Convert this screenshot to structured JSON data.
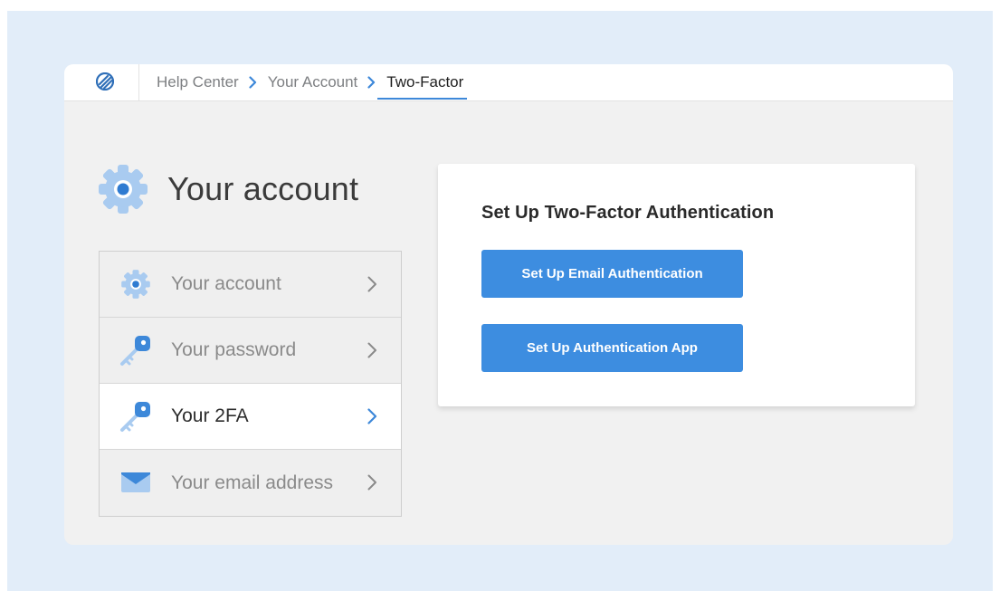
{
  "breadcrumb": {
    "items": [
      "Help Center",
      "Your Account"
    ],
    "current": "Two-Factor"
  },
  "account_header": {
    "title": "Your account",
    "icon": "gear-icon"
  },
  "nav": {
    "items": [
      {
        "label": "Your account",
        "icon": "gear-icon",
        "active": false
      },
      {
        "label": "Your password",
        "icon": "key-icon",
        "active": false
      },
      {
        "label": "Your 2FA",
        "icon": "key-icon",
        "active": true
      },
      {
        "label": "Your email address",
        "icon": "envelope-icon",
        "active": false
      }
    ]
  },
  "card": {
    "heading": "Set Up Two-Factor Authentication",
    "email_button": "Set Up Email Authentication",
    "app_button": "Set Up Authentication App"
  },
  "colors": {
    "accent": "#3d8de0",
    "icon_blue": "#a9cbf0",
    "icon_dark": "#3d88d9",
    "backdrop": "#e2edf9"
  }
}
